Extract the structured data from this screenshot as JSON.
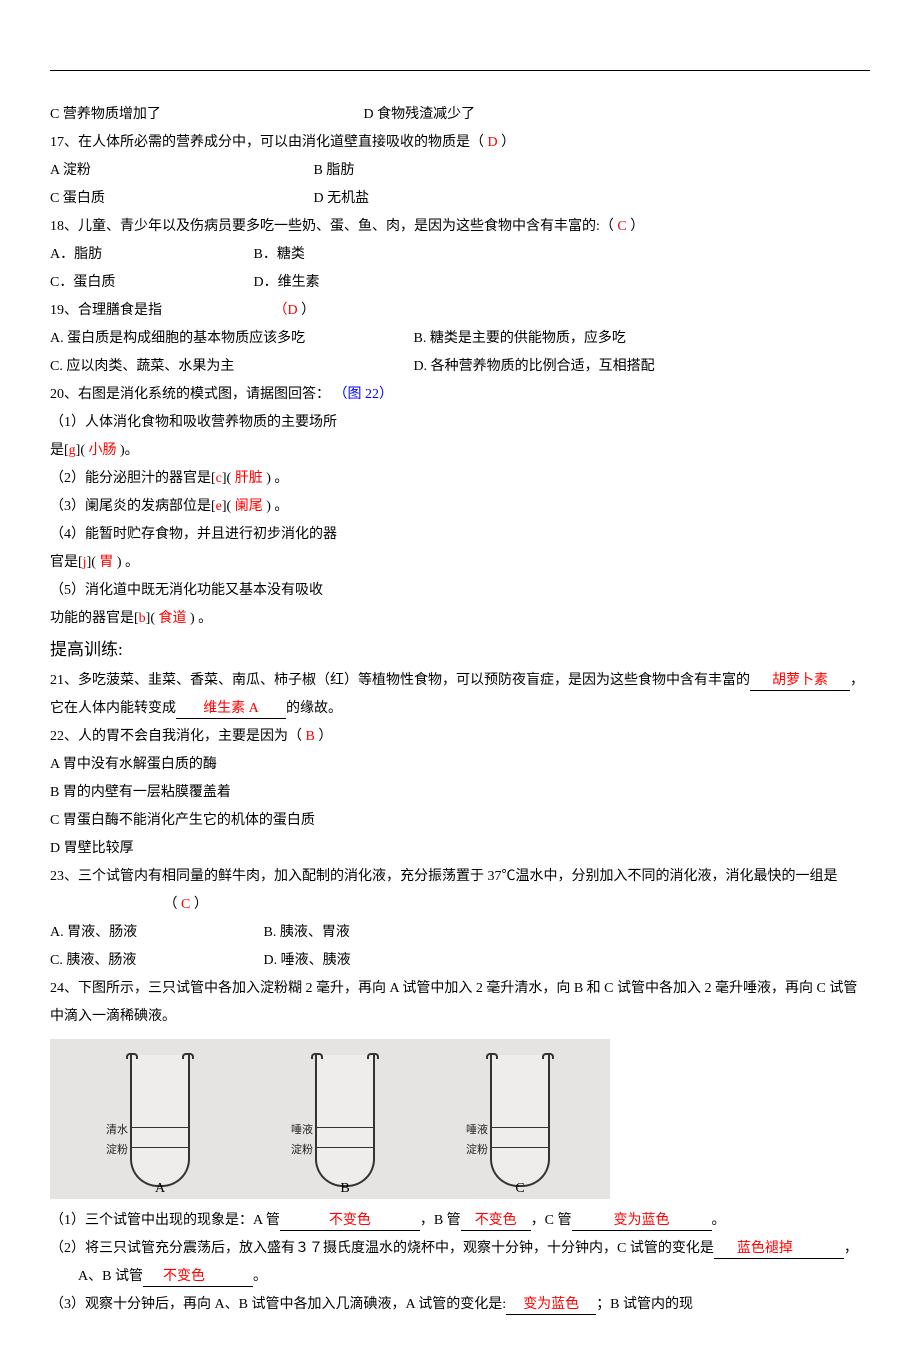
{
  "hr": "",
  "q16": {
    "C": "C 营养物质增加了",
    "D": "D 食物残渣减少了"
  },
  "q17": {
    "stem": "17、在人体所必需的营养成分中，可以由消化道壁直接吸收的物质是（",
    "ans": "D",
    "close": "）",
    "A": "A 淀粉",
    "B": "B 脂肪",
    "C": "C 蛋白质",
    "D": "D 无机盐"
  },
  "q18": {
    "stem": "18、儿童、青少年以及伤病员要多吃一些奶、蛋、鱼、肉，是因为这些食物中含有丰富的:（",
    "ans": "C",
    "close": "）",
    "A": "A．脂肪",
    "B": "B．糖类",
    "C": "C．蛋白质",
    "D": "D．维生素"
  },
  "q19": {
    "stem": "19、合理膳食是指",
    "ans": "（D",
    "close": "）",
    "A": "A. 蛋白质是构成细胞的基本物质应该多吃",
    "B": "B. 糖类是主要的供能物质，应多吃",
    "C": "C. 应以肉类、蔬菜、水果为主",
    "D": "D. 各种营养物质的比例合适，互相搭配"
  },
  "q20": {
    "stem": "20、右图是消化系统的模式图，请据图回答：",
    "figref": "（图 22）",
    "p1a": "（1）人体消化食物和吸收营养物质的主要场所",
    "p1b_pre": "是[",
    "p1b_l": "g",
    "p1b_mid": "](   ",
    "p1b_a": "小肠",
    "p1b_end": "   )。",
    "p2_pre": "（2）能分泌胆汁的器官是[",
    "p2_l": "c",
    "p2_mid": "](   ",
    "p2_a": "肝脏",
    "p2_end": "   ) 。",
    "p3_pre": "（3）阑尾炎的发病部位是[",
    "p3_l": "e",
    "p3_mid": "](   ",
    "p3_a": "阑尾",
    "p3_end": "   ) 。",
    "p4a": "（4）能暂时贮存食物，并且进行初步消化的器",
    "p4b_pre": "官是[",
    "p4b_l": "j",
    "p4b_mid": "](   ",
    "p4b_a": "胃",
    "p4b_end": "   ) 。",
    "p5a": "（5）消化道中既无消化功能又基本没有吸收",
    "p5b_pre": "功能的器官是[",
    "p5b_l": "b",
    "p5b_mid": "](   ",
    "p5b_a": "食道",
    "p5b_end": "   ) 。"
  },
  "section": "提高训练:",
  "q21": {
    "pre": "21、多吃菠菜、韭菜、香菜、南瓜、柿子椒（红）等植物性食物，可以预防夜盲症，是因为这些食物中含有丰富的",
    "a1": "胡萝卜素",
    "mid": "，它在人体内能转变成",
    "a2": "维生素 A",
    "end": "的缘故。"
  },
  "q22": {
    "stem": "22、人的胃不会自我消化，主要是因为（",
    "ans": "B",
    "close": "）",
    "A": "A 胃中没有水解蛋白质的酶",
    "B": "B 胃的内壁有一层粘膜覆盖着",
    "C": "C 胃蛋白酶不能消化产生它的机体的蛋白质",
    "D": "D 胃壁比较厚"
  },
  "q23": {
    "stem": "23、三个试管内有相同量的鲜牛肉，加入配制的消化液，充分振荡置于 37℃温水中，分别加入不同的消化液，消化最快的一组是",
    "paren_open": "（",
    "ans": "C",
    "paren_close": "）",
    "A": "A. 胃液、肠液",
    "B": "B. 胰液、胃液",
    "C": "C. 胰液、肠液",
    "D": "D. 唾液、胰液"
  },
  "q24": {
    "stem1": "24、下图所示，三只试管中各加入淀粉糊 2 毫升，再向 A 试管中加入 2 毫升清水，向 B 和 C 试管中各加入 2 毫升唾液，再向 C 试管中滴入一滴稀碘液。",
    "fig": {
      "A_top": "清水",
      "A_bot": "淀粉",
      "A_cap": "A",
      "B_top": "唾液",
      "B_bot": "淀粉",
      "B_cap": "B",
      "C_top": "唾液",
      "C_bot": "淀粉",
      "C_cap": "C"
    },
    "p1_pre": "（1）三个试管中出现的现象是：A 管",
    "p1_a1": "不变色",
    "p1_mid1": "，B 管",
    "p1_a2": "不变色",
    "p1_mid2": "，C 管",
    "p1_a3": "变为蓝色",
    "p1_end": "。",
    "p2_pre": "（2）将三只试管充分震荡后，放入盛有３７摄氏度温水的烧杯中，观察十分钟，十分钟内，C 试管的变化是",
    "p2_a1": "蓝色褪掉",
    "p2_mid": "，A、B 试管",
    "p2_a2": "不变色",
    "p2_end": "。",
    "p3_pre": "（3）观察十分钟后，再向 A、B 试管中各加入几滴碘液，A 试管的变化是:",
    "p3_a1": "变为蓝色",
    "p3_end": "；B 试管内的现"
  }
}
